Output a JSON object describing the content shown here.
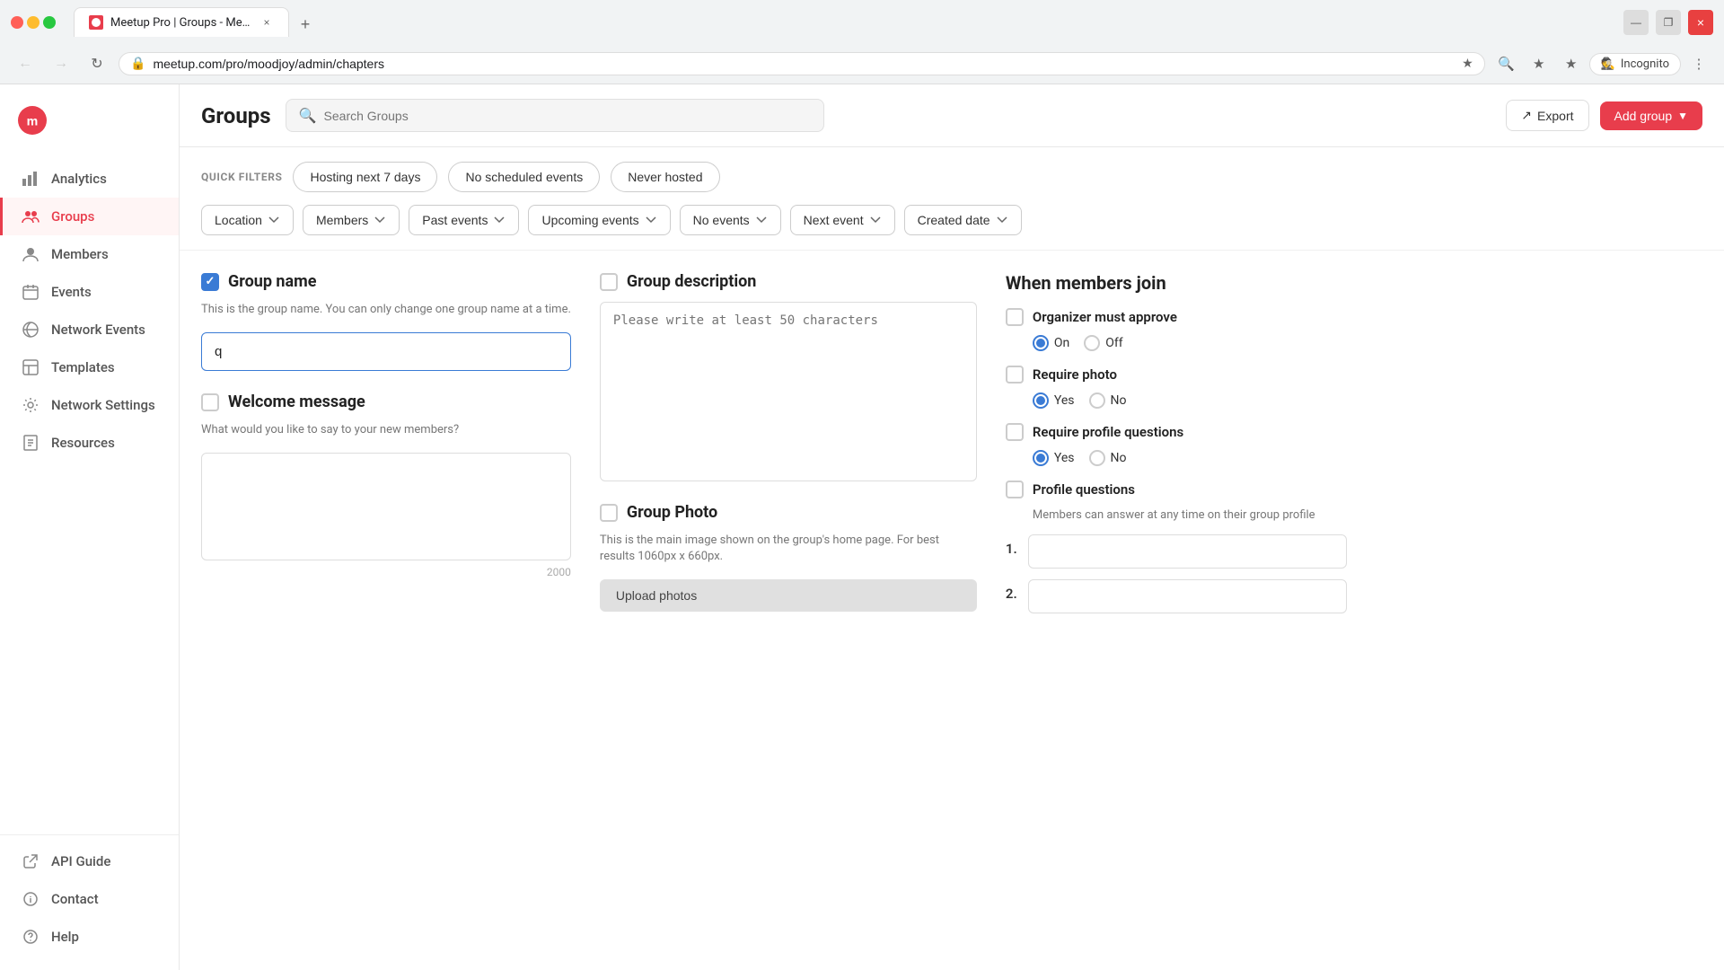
{
  "browser": {
    "tab_title": "Meetup Pro | Groups - Meetup",
    "tab_close": "×",
    "tab_new": "+",
    "url": "meetup.com/pro/moodjoy/admin/chapters",
    "nav_back": "←",
    "nav_forward": "→",
    "nav_refresh": "↻",
    "incognito_label": "Incognito",
    "minimize": "—",
    "restore": "❐",
    "close": "×"
  },
  "sidebar": {
    "items": [
      {
        "id": "analytics",
        "label": "Analytics",
        "icon": "chart"
      },
      {
        "id": "groups",
        "label": "Groups",
        "icon": "groups",
        "active": true
      },
      {
        "id": "members",
        "label": "Members",
        "icon": "members"
      },
      {
        "id": "events",
        "label": "Events",
        "icon": "events"
      },
      {
        "id": "network-events",
        "label": "Network Events",
        "icon": "network"
      },
      {
        "id": "templates",
        "label": "Templates",
        "icon": "templates"
      },
      {
        "id": "network-settings",
        "label": "Network Settings",
        "icon": "settings"
      },
      {
        "id": "resources",
        "label": "Resources",
        "icon": "resources"
      }
    ],
    "bottom_items": [
      {
        "id": "api-guide",
        "label": "API Guide",
        "icon": "link"
      },
      {
        "id": "contact",
        "label": "Contact",
        "icon": "contact"
      },
      {
        "id": "help",
        "label": "Help",
        "icon": "help"
      }
    ]
  },
  "header": {
    "title": "Groups",
    "search_placeholder": "Search Groups",
    "export_label": "Export",
    "add_group_label": "Add group"
  },
  "quick_filters": {
    "label": "QUICK FILTERS",
    "chips": [
      {
        "id": "hosting-next-7",
        "label": "Hosting next 7 days"
      },
      {
        "id": "no-scheduled",
        "label": "No scheduled events"
      },
      {
        "id": "never-hosted",
        "label": "Never hosted"
      }
    ]
  },
  "dropdown_filters": [
    {
      "id": "location",
      "label": "Location"
    },
    {
      "id": "members",
      "label": "Members"
    },
    {
      "id": "past-events",
      "label": "Past events"
    },
    {
      "id": "upcoming-events",
      "label": "Upcoming events"
    },
    {
      "id": "no-events",
      "label": "No events"
    },
    {
      "id": "next-event",
      "label": "Next event"
    },
    {
      "id": "created-date",
      "label": "Created date"
    }
  ],
  "form": {
    "group_name": {
      "label": "Group name",
      "checked": true,
      "description": "This is the group name. You can only change one group name at a time.",
      "value": "q",
      "placeholder": ""
    },
    "welcome_message": {
      "label": "Welcome message",
      "checked": false,
      "placeholder": "What would you like to say to your new members?",
      "value": "",
      "counter": "2000"
    },
    "group_description": {
      "label": "Group description",
      "checked": false,
      "placeholder": "Please write at least 50 characters",
      "value": ""
    },
    "group_photo": {
      "label": "Group Photo",
      "checked": false,
      "description": "This is the main image shown on the group's home page. For best results 1060px x 660px.",
      "upload_label": "Upload photos"
    },
    "when_members_join": {
      "title": "When members join",
      "organizer_must_approve": {
        "label": "Organizer must approve",
        "checked": false
      },
      "on_off": {
        "on_selected": true,
        "off_selected": false,
        "on_label": "On",
        "off_label": "Off"
      },
      "require_photo": {
        "label": "Require photo",
        "checked": false
      },
      "require_photo_radio": {
        "yes_selected": true,
        "no_selected": false,
        "yes_label": "Yes",
        "no_label": "No"
      },
      "require_profile_questions": {
        "label": "Require profile questions",
        "checked": false
      },
      "require_profile_questions_radio": {
        "yes_selected": true,
        "no_selected": false,
        "yes_label": "Yes",
        "no_label": "No"
      },
      "profile_questions": {
        "label": "Profile questions",
        "checked": false,
        "description": "Members can answer at any time on their group profile",
        "numbers": [
          "1.",
          "2."
        ]
      }
    }
  }
}
